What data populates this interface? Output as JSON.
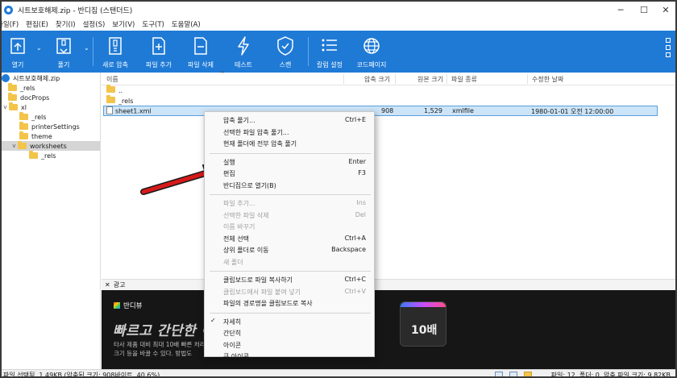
{
  "window": {
    "title": "시트보호해제.zip - 반디집 (스탠더드)",
    "minimize": "─",
    "maximize": "☐",
    "close": "✕"
  },
  "menu": [
    "파일(F)",
    "편집(E)",
    "찾기(I)",
    "설정(S)",
    "보기(V)",
    "도구(T)",
    "도움말(A)"
  ],
  "toolbar": {
    "buttons": [
      {
        "label": "열기",
        "icon": "open-icon"
      },
      {
        "label": "풀기",
        "icon": "extract-icon"
      },
      {
        "label": "새로 압축",
        "icon": "new-archive-icon"
      },
      {
        "label": "파일 추가",
        "icon": "add-file-icon"
      },
      {
        "label": "파일 삭제",
        "icon": "delete-file-icon"
      },
      {
        "label": "테스트",
        "icon": "lightning-icon"
      },
      {
        "label": "스캔",
        "icon": "shield-icon"
      },
      {
        "label": "칼럼 설정",
        "icon": "column-settings-icon"
      },
      {
        "label": "코드페이지",
        "icon": "globe-icon"
      }
    ],
    "accent": "#1f7ad6"
  },
  "tree": {
    "items": [
      {
        "label": "시트보호해제.zip",
        "type": "zip",
        "chevron": ""
      },
      {
        "label": "_rels",
        "type": "folder",
        "chevron": ""
      },
      {
        "label": "docProps",
        "type": "folder",
        "chevron": ""
      },
      {
        "label": "xl",
        "type": "folder",
        "chevron": "v"
      },
      {
        "label": "_rels",
        "type": "folder",
        "chevron": ""
      },
      {
        "label": "printerSettings",
        "type": "folder",
        "chevron": ""
      },
      {
        "label": "theme",
        "type": "folder",
        "chevron": ""
      },
      {
        "label": "worksheets",
        "type": "folder",
        "chevron": "v"
      },
      {
        "label": "_rels",
        "type": "folder",
        "chevron": ""
      }
    ]
  },
  "list": {
    "columns": [
      "이름",
      "압축 크기",
      "원본 크기",
      "파일 종류",
      "수정한 날짜"
    ],
    "sort_indicator": "^",
    "rows": [
      {
        "name": "..",
        "type": "folder",
        "packed": "",
        "size": "",
        "kind": "",
        "date": ""
      },
      {
        "name": "_rels",
        "type": "folder",
        "packed": "",
        "size": "",
        "kind": "",
        "date": ""
      },
      {
        "name": "sheet1.xml",
        "type": "file",
        "packed": "908",
        "size": "1,529",
        "kind": "xmlfile",
        "date": "1980-01-01 오전 12:00:00"
      }
    ]
  },
  "ad": {
    "close": "✕",
    "label": "광고",
    "brand": "반디뷰",
    "headline_a": "빠르고 간단한",
    "headline_b": "이",
    "sub_1": "타사 제품 대비 최대 10배 빠른 처리",
    "sub_2": "크기 등을 바꿀 수 있다. 방법도",
    "badge": "10배"
  },
  "status": {
    "left": "파일 선택됨, 1.49KB (압축된 크기: 908바이트, 40.6%)",
    "right": "파일: 12, 폴더: 0, 압축 파일 크기: 9.82KB"
  },
  "context_menu": {
    "groups": [
      [
        {
          "label": "압축 풀기...",
          "shortcut": "Ctrl+E",
          "disabled": false,
          "checked": false
        },
        {
          "label": "선택한 파일 압축 풀기...",
          "shortcut": "",
          "disabled": false,
          "checked": false
        },
        {
          "label": "현재 폴더에 전부 압축 풀기",
          "shortcut": "",
          "disabled": false,
          "checked": false
        }
      ],
      [
        {
          "label": "실행",
          "shortcut": "Enter",
          "disabled": false,
          "checked": false
        },
        {
          "label": "편집",
          "shortcut": "F3",
          "disabled": false,
          "checked": false
        },
        {
          "label": "반디집으로 열기(B)",
          "shortcut": "",
          "disabled": false,
          "checked": false
        }
      ],
      [
        {
          "label": "파일 추가...",
          "shortcut": "Ins",
          "disabled": true,
          "checked": false
        },
        {
          "label": "선택한 파일 삭제",
          "shortcut": "Del",
          "disabled": true,
          "checked": false
        },
        {
          "label": "이름 바꾸기",
          "shortcut": "",
          "disabled": true,
          "checked": false
        },
        {
          "label": "전체 선택",
          "shortcut": "Ctrl+A",
          "disabled": false,
          "checked": false
        },
        {
          "label": "상위 폴더로 이동",
          "shortcut": "Backspace",
          "disabled": false,
          "checked": false
        },
        {
          "label": "새 폴더",
          "shortcut": "",
          "disabled": true,
          "checked": false
        }
      ],
      [
        {
          "label": "클립보드로 파일 복사하기",
          "shortcut": "Ctrl+C",
          "disabled": false,
          "checked": false
        },
        {
          "label": "클립보드에서 파일 붙여 넣기",
          "shortcut": "Ctrl+V",
          "disabled": true,
          "checked": false
        },
        {
          "label": "파일의 경로명을 클립보드로 복사",
          "shortcut": "",
          "disabled": false,
          "checked": false
        }
      ],
      [
        {
          "label": "자세히",
          "shortcut": "",
          "disabled": false,
          "checked": true
        },
        {
          "label": "간단히",
          "shortcut": "",
          "disabled": false,
          "checked": false
        },
        {
          "label": "아이콘",
          "shortcut": "",
          "disabled": false,
          "checked": false
        },
        {
          "label": "큰 아이콘",
          "shortcut": "",
          "disabled": false,
          "checked": false
        }
      ]
    ],
    "check_glyph": "✓"
  },
  "annotation": {
    "arrow_color": "#d61a1a"
  }
}
